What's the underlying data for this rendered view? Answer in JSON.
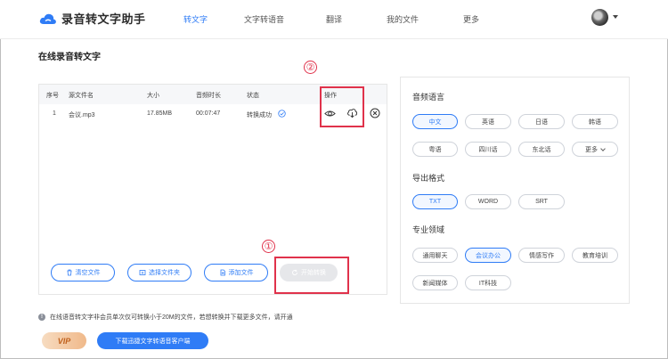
{
  "app": {
    "logo_text": "录音转文字助手"
  },
  "nav": {
    "items": [
      {
        "label": "转文字",
        "active": true
      },
      {
        "label": "文字转语音",
        "active": false
      },
      {
        "label": "翻译",
        "active": false
      },
      {
        "label": "我的文件",
        "active": false
      },
      {
        "label": "更多",
        "active": false
      }
    ]
  },
  "page_title": "在线录音转文字",
  "table": {
    "headers": [
      "序号",
      "源文件名",
      "大小",
      "音频时长",
      "状态",
      "操作"
    ],
    "rows": [
      {
        "index": "1",
        "name": "会议.mp3",
        "size": "17.85MB",
        "duration": "00:07:47",
        "status": "转换成功"
      }
    ],
    "op_icons": [
      "eye-icon",
      "cloud-download-icon",
      "close-circle-icon"
    ]
  },
  "actions": {
    "clear": "清空文件",
    "select_folder": "选择文件夹",
    "add_file": "添加文件",
    "start": "开始转换"
  },
  "annotations": {
    "one": "①",
    "two": "②",
    "color": "#e0324b"
  },
  "settings": {
    "language": {
      "title": "音频语言",
      "options": [
        "中文",
        "英语",
        "日语",
        "韩语",
        "粤语",
        "四川话",
        "东北话",
        "更多"
      ],
      "selected": "中文"
    },
    "format": {
      "title": "导出格式",
      "options": [
        "TXT",
        "WORD",
        "SRT"
      ],
      "selected": "TXT"
    },
    "domain": {
      "title": "专业领域",
      "options": [
        "通用聊天",
        "会议办公",
        "情感写作",
        "教育培训",
        "新闻媒体",
        "IT科技"
      ],
      "selected": "会议办公"
    }
  },
  "footer": {
    "notice": "在线语音转文字非会员单次仅可转换小于20M的文件，若想转换并下载更多文件，请开通",
    "vip": "VIP",
    "download": "下载迅捷文字转语音客户端"
  },
  "colors": {
    "accent": "#2f7cf6",
    "annotation": "#e0324b"
  }
}
